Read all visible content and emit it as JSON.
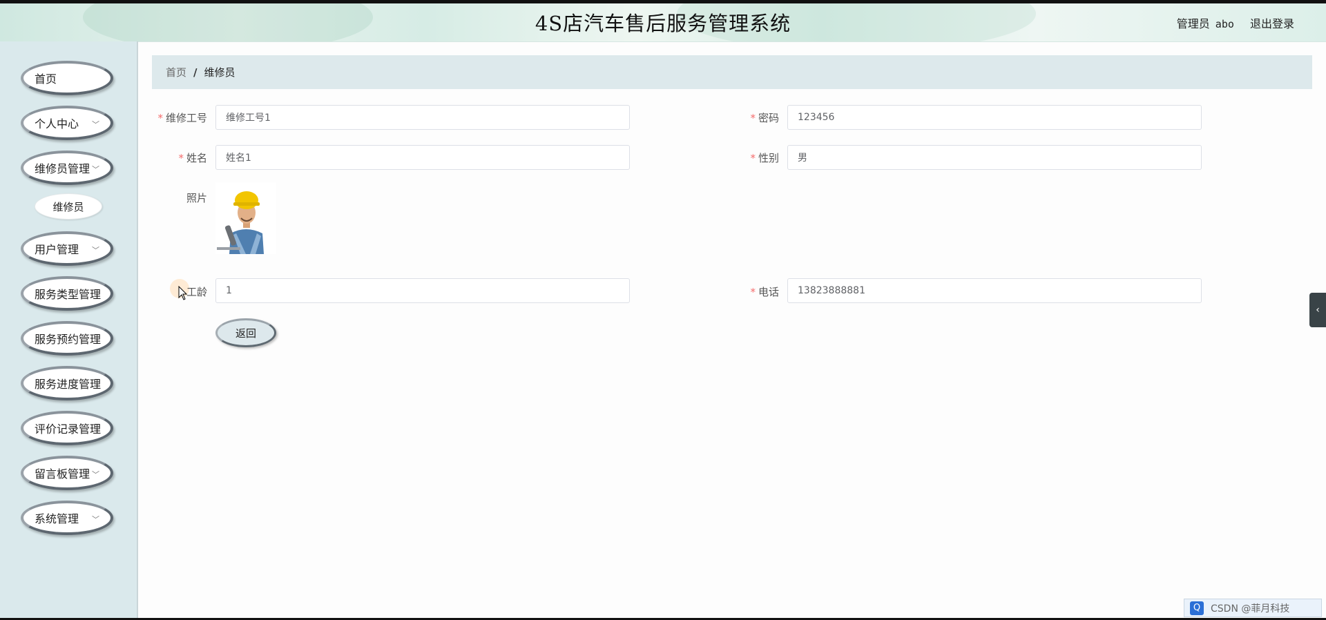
{
  "header": {
    "title": "4S店汽车售后服务管理系统",
    "role_label": "管理员",
    "username": "abo",
    "logout_label": "退出登录"
  },
  "sidebar": {
    "items": [
      {
        "label": "首页",
        "has_children": false
      },
      {
        "label": "个人中心",
        "has_children": true
      },
      {
        "label": "维修员管理",
        "has_children": true
      },
      {
        "label": "维修员",
        "is_submenu": true,
        "active": true
      },
      {
        "label": "用户管理",
        "has_children": true
      },
      {
        "label": "服务类型管理",
        "has_children": true
      },
      {
        "label": "服务预约管理",
        "has_children": true
      },
      {
        "label": "服务进度管理",
        "has_children": true
      },
      {
        "label": "评价记录管理",
        "has_children": true
      },
      {
        "label": "留言板管理",
        "has_children": true
      },
      {
        "label": "系统管理",
        "has_children": true
      }
    ]
  },
  "breadcrumb": {
    "home": "首页",
    "separator": "/",
    "current": "维修员"
  },
  "form": {
    "required_mark": "*",
    "repair_id": {
      "label": "维修工号",
      "required": true,
      "value": "维修工号1"
    },
    "password": {
      "label": "密码",
      "required": true,
      "value": "123456"
    },
    "name": {
      "label": "姓名",
      "required": true,
      "value": "姓名1"
    },
    "gender": {
      "label": "性别",
      "required": true,
      "value": "男"
    },
    "photo": {
      "label": "照片"
    },
    "work_years": {
      "label": "工龄",
      "required": false,
      "value": "1"
    },
    "phone": {
      "label": "电话",
      "required": true,
      "value": "13823888881"
    }
  },
  "actions": {
    "back_label": "返回"
  },
  "overlay": {
    "watermark_text": "CSDN @菲月科技",
    "toggle_icon": "chevron-left-icon"
  },
  "colors": {
    "sidebar_bg": "#dae9ec",
    "breadcrumb_bg": "#dde9ec",
    "required": "#f56c6c"
  }
}
